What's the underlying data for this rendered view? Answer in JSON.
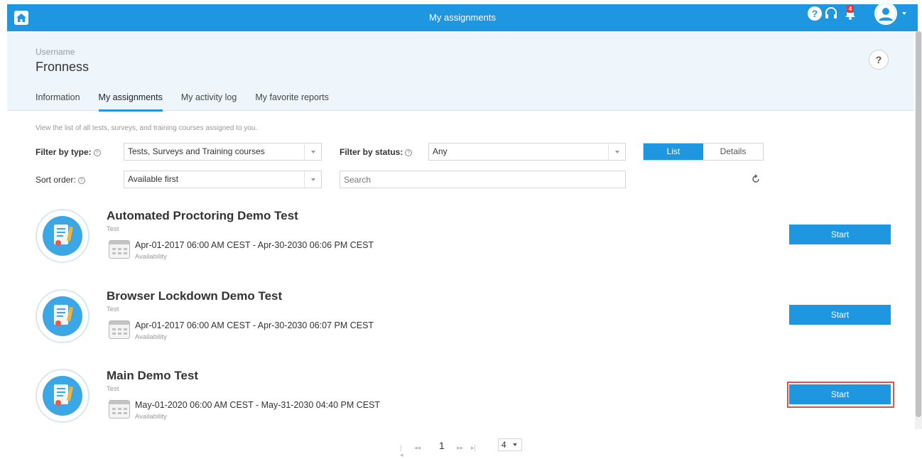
{
  "topbar": {
    "title": "My assignments",
    "help_glyph": "?",
    "notification_count": "4",
    "colors": {
      "bar": "#1e97e0",
      "badge": "#e53935"
    },
    "icons": [
      "home-icon",
      "help-icon",
      "headset-icon",
      "bell-icon",
      "user-avatar-icon",
      "chevron-down-icon"
    ]
  },
  "profile": {
    "username_label": "Username",
    "username_value": "Fronness",
    "help_glyph": "?"
  },
  "tabs": [
    {
      "label": "Information"
    },
    {
      "label": "My assignments",
      "active": true
    },
    {
      "label": "My activity log"
    },
    {
      "label": "My favorite reports"
    }
  ],
  "filters": {
    "description": "View the list of all tests, surveys, and training courses assigned to you.",
    "type_label": "Filter by type:",
    "type_value": "Tests, Surveys and Training courses",
    "status_label": "Filter by status:",
    "status_value": "Any",
    "sort_label": "Sort order:",
    "sort_value": "Available first",
    "search_placeholder": "Search",
    "view_list": "List",
    "view_details": "Details",
    "selected_view": "List"
  },
  "assignments": [
    {
      "title": "Automated Proctoring Demo Test",
      "type": "Test",
      "dates": "Apr-01-2017 06:00 AM CEST - Apr-30-2030 06:06 PM CEST",
      "availability_label": "Availability",
      "action": "Start"
    },
    {
      "title": "Browser Lockdown Demo Test",
      "type": "Test",
      "dates": "Apr-01-2017 06:00 AM CEST - Apr-30-2030 06:07 PM CEST",
      "availability_label": "Availability",
      "action": "Start"
    },
    {
      "title": "Main Demo Test",
      "type": "Test",
      "dates": "May-01-2020 06:00 AM CEST - May-31-2030 04:40 PM CEST",
      "availability_label": "Availability",
      "action": "Start",
      "highlighted": true
    }
  ],
  "pagination": {
    "current_page": "1",
    "page_size": "4",
    "first_glyph": "|◂",
    "prev_glyph": "◂◂",
    "next_glyph": "▸▸",
    "last_glyph": "▸|"
  }
}
